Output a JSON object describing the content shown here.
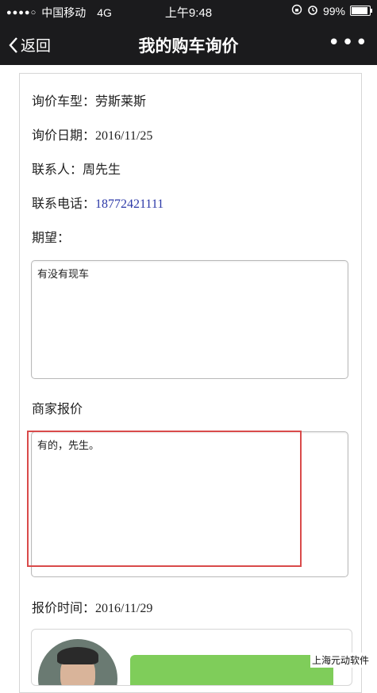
{
  "status_bar": {
    "signal": "●●●●○",
    "carrier": "中国移动",
    "network": "4G",
    "time": "上午9:48",
    "battery": "99%",
    "battery_level": 0.99
  },
  "nav": {
    "back_label": "返回",
    "title": "我的购车询价",
    "more_label": "•••"
  },
  "inquiry": {
    "model_label": "询价车型：",
    "model_value": "劳斯莱斯",
    "date_label": "询价日期：",
    "date_value": "2016/11/25",
    "contact_label": "联系人：",
    "contact_value": "周先生",
    "phone_label": "联系电话：",
    "phone_value": "18772421111",
    "expect_label": "期望：",
    "expect_text": "有没有现车",
    "quote_label": "商家报价",
    "quote_text": "有的，先生。",
    "quote_time_label": "报价时间：",
    "quote_time_value": "2016/11/29"
  },
  "watermark": "上海元动软件"
}
